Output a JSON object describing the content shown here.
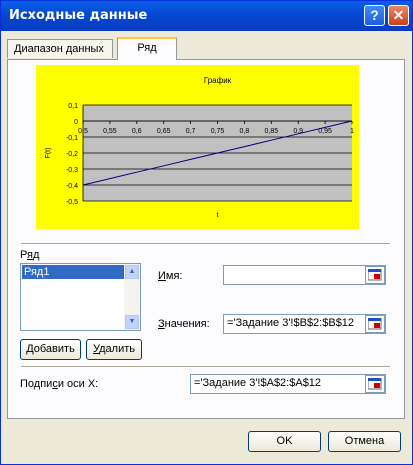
{
  "window": {
    "title": "Исходные данные",
    "help_glyph": "?",
    "close_glyph": "✕"
  },
  "tabs": [
    {
      "label": "Диапазон данных",
      "active": false
    },
    {
      "label": "Ряд",
      "active": true
    }
  ],
  "chart_data": {
    "type": "line",
    "title": "График",
    "xlabel": "t",
    "ylabel": "F(t)",
    "x_ticks": [
      "0,5",
      "0,55",
      "0,6",
      "0,65",
      "0,7",
      "0,75",
      "0,8",
      "0,85",
      "0,9",
      "0,95",
      "1"
    ],
    "y_ticks": [
      "0,1",
      "0",
      "-0,1",
      "-0,2",
      "-0,3",
      "-0,4",
      "-0,5"
    ],
    "xlim": [
      0.5,
      1
    ],
    "ylim": [
      -0.5,
      0.1
    ],
    "grid": true,
    "background": "#ffff00",
    "plot_area_color": "#c0c0c0",
    "series": [
      {
        "color": "#000080",
        "x": [
          0.5,
          0.55,
          0.6,
          0.65,
          0.7,
          0.75,
          0.8,
          0.85,
          0.9,
          0.95,
          1
        ],
        "values": [
          -0.4,
          -0.36,
          -0.32,
          -0.28,
          -0.24,
          -0.2,
          -0.16,
          -0.12,
          -0.08,
          -0.04,
          0
        ]
      }
    ]
  },
  "series_group": {
    "label": "Ряд",
    "items": [
      "Ряд1"
    ],
    "selected": "Ряд1",
    "add_button": "Добавить",
    "delete_button": "Удалить"
  },
  "name_field": {
    "label": "Имя:",
    "value": ""
  },
  "values_field": {
    "label": "Значения:",
    "value": "='Задание 3'!$B$2:$B$12"
  },
  "xlabels_field": {
    "label": "Подписи оси X:",
    "value": "='Задание 3'!$A$2:$A$12"
  },
  "buttons": {
    "ok": "OK",
    "cancel": "Отмена"
  },
  "colors": {
    "titlebar": "#0548d1",
    "selection": "#316ac5",
    "dialog_bg": "#ece9d8"
  }
}
